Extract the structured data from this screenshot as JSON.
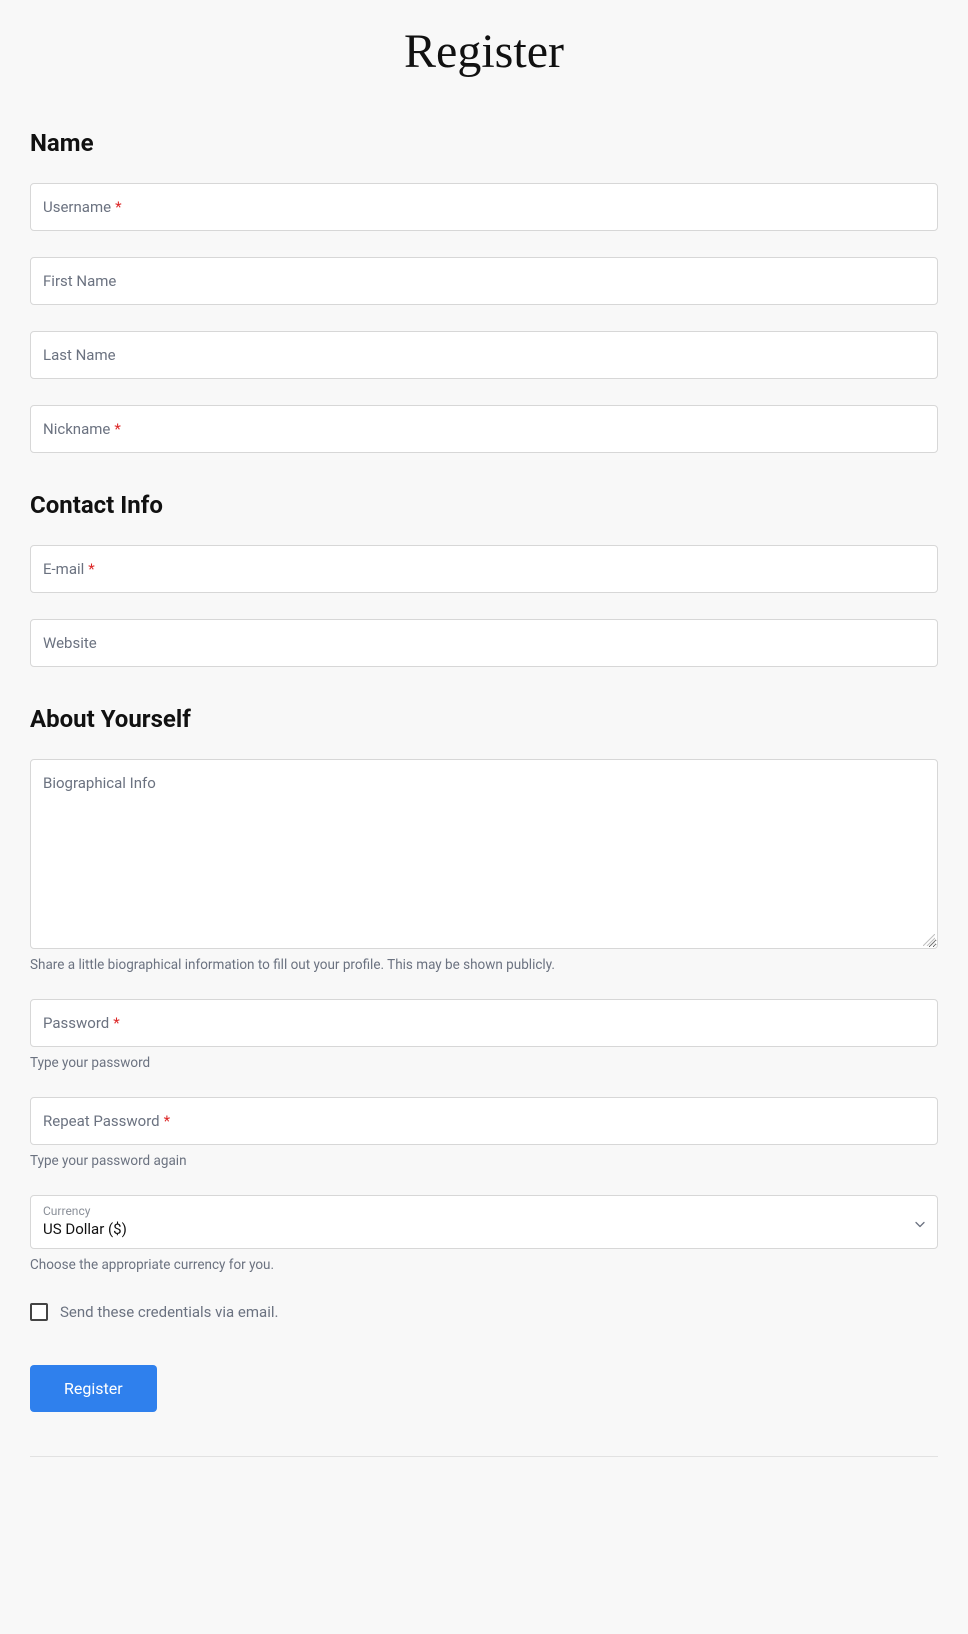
{
  "pageTitle": "Register",
  "sections": {
    "name": {
      "heading": "Name"
    },
    "contact": {
      "heading": "Contact Info"
    },
    "about": {
      "heading": "About Yourself"
    }
  },
  "fields": {
    "username": {
      "label": "Username",
      "required": "*"
    },
    "firstName": {
      "label": "First Name"
    },
    "lastName": {
      "label": "Last Name"
    },
    "nickname": {
      "label": "Nickname",
      "required": "*"
    },
    "email": {
      "label": "E-mail",
      "required": "*"
    },
    "website": {
      "label": "Website"
    },
    "bio": {
      "label": "Biographical Info",
      "help": "Share a little biographical information to fill out your profile. This may be shown publicly."
    },
    "password": {
      "label": "Password",
      "required": "*",
      "help": "Type your password"
    },
    "repeatPassword": {
      "label": "Repeat Password",
      "required": "*",
      "help": "Type your password again"
    },
    "currency": {
      "smallLabel": "Currency",
      "value": "US Dollar ($)",
      "help": "Choose the appropriate currency for you."
    },
    "sendCredentials": {
      "label": "Send these credentials via email."
    }
  },
  "submit": {
    "label": "Register"
  }
}
